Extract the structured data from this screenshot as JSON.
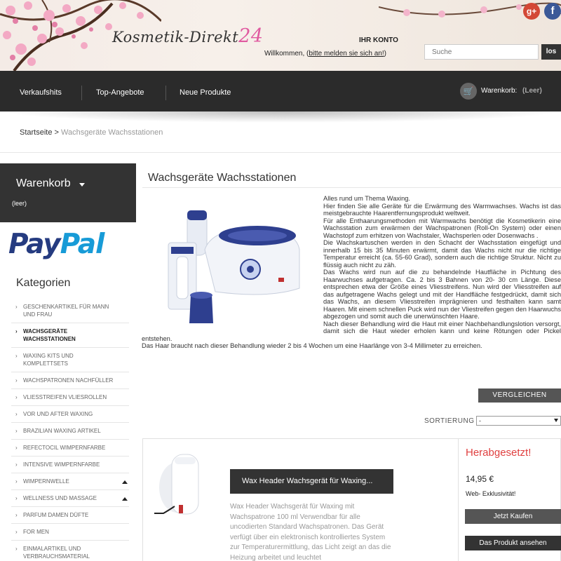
{
  "header": {
    "logo_text": "Kosmetik-Direkt",
    "logo_number": "24",
    "account_title": "IHR KONTO",
    "welcome_prefix": "Willkommen, (",
    "login_link": "bitte melden sie sich an!",
    "welcome_suffix": ")",
    "search_placeholder": "Suche",
    "search_button": "los",
    "social": {
      "gplus_label": "g+",
      "facebook_label": "f"
    }
  },
  "nav": {
    "items": [
      "Verkaufshits",
      "Top-Angebote",
      "Neue Produkte"
    ],
    "cart_label": "Warenkorb:",
    "cart_status": "(Leer)"
  },
  "breadcrumb": {
    "home": "Startseite",
    "separator": ">",
    "current": "Wachsgeräte Wachsstationen"
  },
  "sidebar": {
    "cart_title": "Warenkorb",
    "cart_empty": "(leer)",
    "paypal_part1": "Pay",
    "paypal_part2": "Pal",
    "categories_title": "Kategorien",
    "categories": [
      {
        "label": "Geschenkartikel für Mann und Frau",
        "active": false,
        "expand": false
      },
      {
        "label": "Wachsgeräte Wachsstationen",
        "active": true,
        "expand": false
      },
      {
        "label": "Waxing Kits und Komplettsets",
        "active": false,
        "expand": false
      },
      {
        "label": "Wachspatronen Nachfüller",
        "active": false,
        "expand": false
      },
      {
        "label": "Vliesstreifen Vliesrollen",
        "active": false,
        "expand": false
      },
      {
        "label": "Vor und After Waxing",
        "active": false,
        "expand": false
      },
      {
        "label": "Brazilian Waxing Artikel",
        "active": false,
        "expand": false
      },
      {
        "label": "Refectocil Wimpernfarbe",
        "active": false,
        "expand": false
      },
      {
        "label": "Intensive Wimpernfarbe",
        "active": false,
        "expand": false
      },
      {
        "label": "Wimpernwelle",
        "active": false,
        "expand": true
      },
      {
        "label": "Wellness und Massage",
        "active": false,
        "expand": true
      },
      {
        "label": "Parfum Damen Düfte",
        "active": false,
        "expand": false
      },
      {
        "label": "For Men",
        "active": false,
        "expand": false
      },
      {
        "label": "Einmalartikel und Verbrauchsmaterial",
        "active": false,
        "expand": false
      }
    ]
  },
  "main": {
    "title": "Wachsgeräte Wachsstationen",
    "description": [
      "Alles rund um Thema Waxing.",
      "Hier finden Sie alle Geräte für die Erwärmung des Warmwachses. Wachs ist das meistgebrauchte Haarentfernungsprodukt weltweit.",
      "Für alle Enthaarungsmethoden mit Warmwachs benötigt die Kosmetikerin eine Wachsstation zum erwärmen der Wachspatronen (Roll-On System) oder einen Wachstopf zum erhitzen von Wachstaler, Wachsperlen oder Dosenwachs .",
      "Die Wachskartuschen werden in den Schacht der Wachsstation eingefügt und innerhalb 15 bis 35 Minuten erwärmt, damit das Wachs nicht nur die richtige Temperatur erreicht (ca. 55-60 Grad), sondern auch die richtige Struktur. Nicht zu flüssig auch nicht zu zäh.",
      "Das Wachs wird nun auf die zu behandelnde Hautfläche in Pichtung des Haarwuchses aufgetragen. Ca. 2 bis 3 Bahnen von 20- 30 cm Länge. Diese entsprechen etwa der Größe eines Vliesstreifens. Nun wird der Vliesstreifen auf das aufgetragene Wachs gelegt und mit der Handfläche festgedrückt, damit sich das Wachs, an diesem Vliesstreifen imprägnieren und festhalten kann samt Haaren. Mit einem schnellen Puck wird nun der Vliestreifen gegen den Haarwuchs abgezogen und somit auch die unerwünschten Haare.",
      "Nach dieser Behandlung wird die Haut mit einer Nachbehandlungslotion versorgt, damit sich die Haut wieder erholen kann und keine Rötungen oder Pickel entstehen.",
      "Das Haar braucht nach dieser Behandlung wieder 2 bis 4 Wochen um eine Haarlänge von 3-4 Millimeter zu erreichen."
    ],
    "compare_button": "VERGLEICHEN",
    "sort_label": "SORTIERUNG",
    "sort_value": "-"
  },
  "product": {
    "name": "Wax Header Wachsgerät für Waxing...",
    "description": "Wax Header Wachsgerät für Waxing mit Wachspatrone 100 ml Verwendbar für alle uncodierten Standard Wachspatronen. Das Gerät verfügt über ein elektronisch kontrolliertes System zur Temperaturermittlung, das Licht zeigt an das die Heizung arbeitet und leuchtet",
    "discount_label": "Herabgesetzt!",
    "price": "14,95 €",
    "exclusive": "Web- Exklusivität!",
    "buy_button": "Jetzt Kaufen",
    "view_button": "Das Produkt ansehen"
  },
  "colors": {
    "nav_bg": "#2b2b2b",
    "accent_pink": "#e05aa0",
    "discount_red": "#e04040",
    "paypal_dark": "#253b80",
    "paypal_light": "#179bd7"
  }
}
